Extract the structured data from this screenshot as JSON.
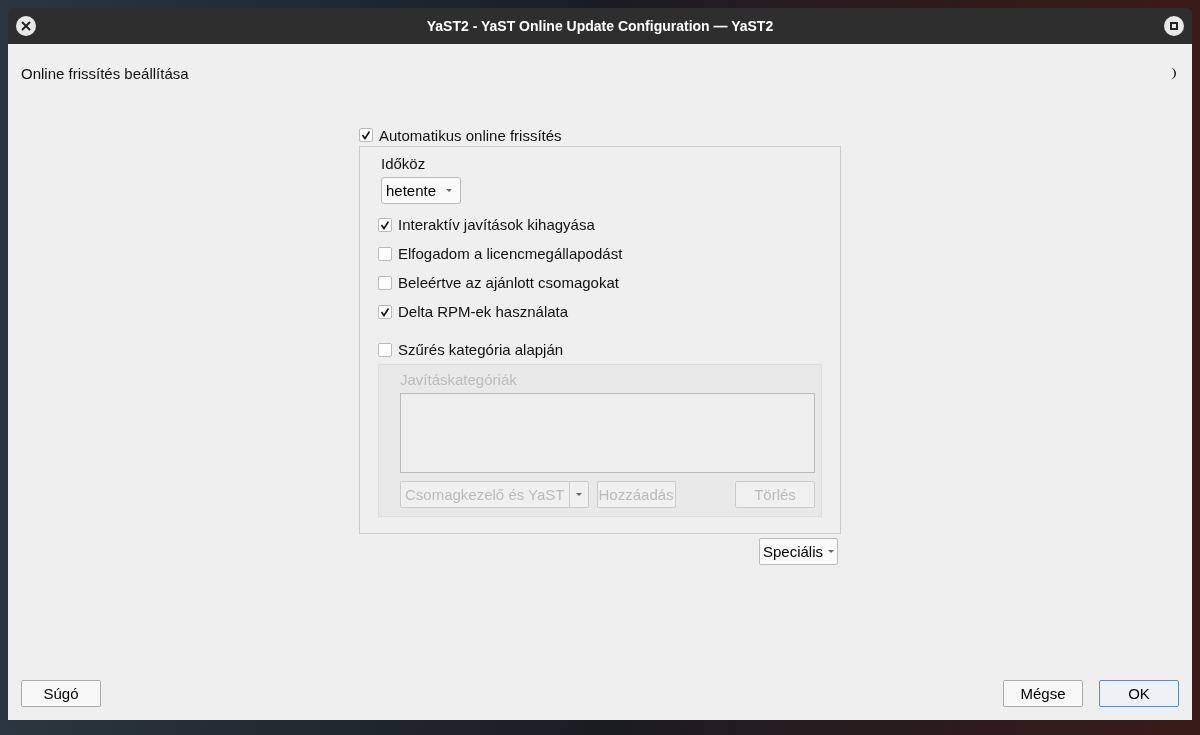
{
  "window": {
    "title": "YaST2 - YaST Online Update Configuration — YaST2"
  },
  "heading": "Online frissítés beállítása",
  "auto_update": {
    "label": "Automatikus online frissítés",
    "checked": true
  },
  "interval": {
    "label": "Időköz",
    "value": "hetente"
  },
  "options": [
    {
      "label": "Interaktív javítások kihagyása",
      "checked": true
    },
    {
      "label": "Elfogadom a licencmegállapodást",
      "checked": false
    },
    {
      "label": "Beleértve az ajánlott csomagokat",
      "checked": false
    },
    {
      "label": "Delta RPM-ek használata",
      "checked": true
    }
  ],
  "filter": {
    "label": "Szűrés kategória alapján",
    "checked": false
  },
  "categories": {
    "label": "Javításkategóriák",
    "disabled": true,
    "combo": "Csomagkezelő és YaST",
    "add": "Hozzáadás",
    "remove": "Törlés"
  },
  "advanced_button": "Speciális",
  "buttons": {
    "help": "Súgó",
    "cancel": "Mégse",
    "ok": "OK"
  }
}
